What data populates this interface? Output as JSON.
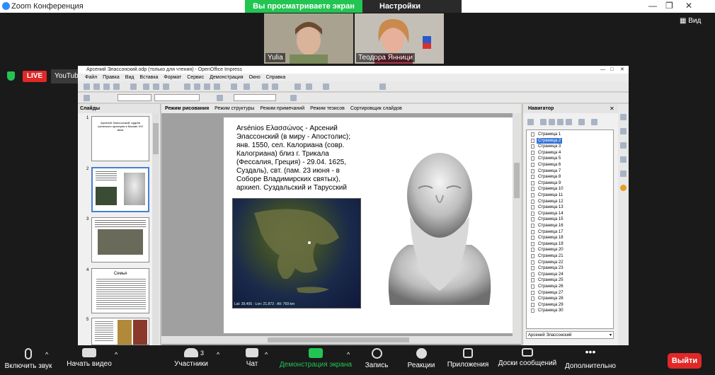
{
  "zoom": {
    "window_title": "Zoom Конференция",
    "sharing_banner": "Вы просматриваете экран Yulia",
    "view_options": "Настройки просмотра",
    "view_button": "Вид",
    "live_badge": "LIVE",
    "youtube_badge": "YouTube",
    "participants": [
      {
        "name": "Yulia"
      },
      {
        "name": "Теодора Янници"
      }
    ],
    "bottom": {
      "mute": "Включить звук",
      "video": "Начать видео",
      "participants": "Участники",
      "participants_count": "3",
      "chat": "Чат",
      "share": "Демонстрация экрана",
      "record": "Запись",
      "reactions": "Реакции",
      "apps": "Приложения",
      "whiteboards": "Доски сообщений",
      "more": "Дополнительно",
      "end": "Выйти"
    }
  },
  "openoffice": {
    "title": "Арсений Элассонский.odp (только для чтения) - OpenOffice Impress",
    "menu": [
      "Файл",
      "Правка",
      "Вид",
      "Вставка",
      "Формат",
      "Сервис",
      "Демонстрация",
      "Окно",
      "Справка"
    ],
    "slides_panel_title": "Слайды",
    "view_tabs": [
      "Режим рисования",
      "Режим структуры",
      "Режим примечаний",
      "Режим тезисов",
      "Сортировщик слайдов"
    ],
    "slide_text": "Arsénios Ελασσώνος - Арсений Элассонский (в миру - Апостолис); янв. 1550, сел. Калориана (совр. Калогриана) близ г. Трикала (Фессалия, Греция) - 29.04. 1625, Суздаль), свт. (пам. 23 июня - в Соборе Владимирских святых), архиеп. Суздальский и Тарусский",
    "map_caption": "Lat: 39.406 · Lon: 21.873 · Alt: 769 km",
    "thumbs": [
      {
        "num": "1",
        "text": "Арсений Элассонский: судьба греческого архиерея в Москве XVI века"
      },
      {
        "num": "2",
        "text": ""
      },
      {
        "num": "3",
        "text": ""
      },
      {
        "num": "4",
        "text": "Семья"
      },
      {
        "num": "5",
        "text": ""
      }
    ],
    "navigator": {
      "title": "Навигатор",
      "pages": [
        "Страница 1",
        "Страница 2",
        "Страница 3",
        "Страница 4",
        "Страница 5",
        "Страница 6",
        "Страница 7",
        "Страница 8",
        "Страница 9",
        "Страница 10",
        "Страница 11",
        "Страница 12",
        "Страница 13",
        "Страница 14",
        "Страница 15",
        "Страница 16",
        "Страница 17",
        "Страница 18",
        "Страница 19",
        "Страница 20",
        "Страница 21",
        "Страница 22",
        "Страница 23",
        "Страница 24",
        "Страница 25",
        "Страница 26",
        "Страница 27",
        "Страница 28",
        "Страница 29",
        "Страница 30"
      ],
      "selected_page": 2,
      "document": "Арсений Элассонский"
    }
  }
}
